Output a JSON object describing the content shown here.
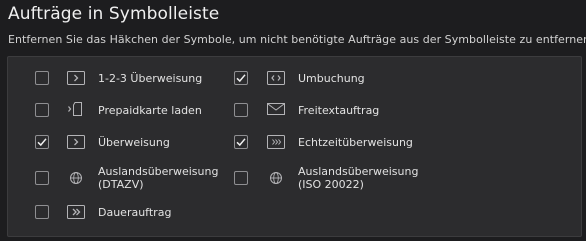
{
  "title": "Aufträge in Symbolleiste",
  "subtitle": "Entfernen Sie das Häkchen der Symbole, um nicht benötigte Aufträge aus der Symbolleiste zu entfernen.",
  "items": [
    {
      "label": "1-2-3 Überweisung",
      "checked": false,
      "icon": "chevron-box-icon"
    },
    {
      "label": "Umbuchung",
      "checked": true,
      "icon": "code-brackets-box-icon"
    },
    {
      "label": "Prepaidkarte laden",
      "checked": false,
      "icon": "prepaid-card-icon"
    },
    {
      "label": "Freitextauftrag",
      "checked": false,
      "icon": "envelope-icon"
    },
    {
      "label": "Überweisung",
      "checked": true,
      "icon": "chevron-box-icon"
    },
    {
      "label": "Echtzeitüberweisung",
      "checked": true,
      "icon": "fast-forward-box-icon"
    },
    {
      "label_line1": "Auslandsüberweisung",
      "label_line2": "(DTAZV)",
      "checked": false,
      "icon": "globe-icon"
    },
    {
      "label_line1": "Auslandsüberweisung",
      "label_line2": "(ISO 20022)",
      "checked": false,
      "icon": "globe-icon"
    },
    {
      "label": "Dauerauftrag",
      "checked": false,
      "icon": "double-chevron-box-icon"
    }
  ],
  "colors": {
    "background": "#1d1d1f",
    "panel": "#2c2c2e",
    "checkbox_border": "#8f8f92",
    "icon": "#b4b4b7"
  }
}
